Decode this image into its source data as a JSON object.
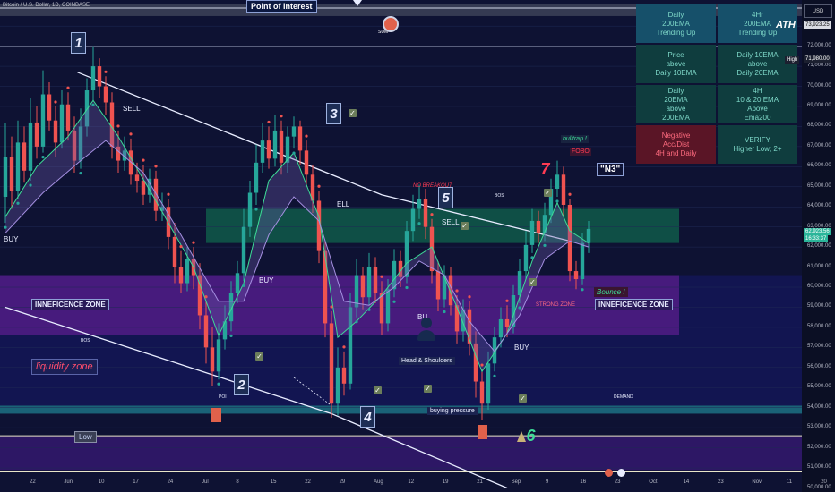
{
  "header": {
    "title": "Bitcoin / U.S. Dollar, 1D, COINBASE",
    "point_of_interest": "Point of Interest",
    "ath": "ATH",
    "currency": "USD"
  },
  "status_table": [
    {
      "text": "Daily\n200EMA\nTrending Up",
      "negative": false,
      "top": true
    },
    {
      "text": "4Hr\n200EMA\nTrending Up",
      "negative": false,
      "top": true
    },
    {
      "text": "Price\nabove\nDaily 10EMA",
      "negative": false,
      "top": false
    },
    {
      "text": "Daily 10EMA\nabove\nDaily 20EMA",
      "negative": false,
      "top": false
    },
    {
      "text": "Daily\n20EMA\nabove\n200EMA",
      "negative": false,
      "top": false
    },
    {
      "text": "4H\n10 & 20 EMA\nAbove\nEma200",
      "negative": false,
      "top": false
    },
    {
      "text": "Negative\nAcc/Dist\n4H and Daily",
      "negative": true,
      "top": false
    },
    {
      "text": "VERIFY\nHigher Low; 2+",
      "negative": false,
      "top": false
    }
  ],
  "annotations": {
    "waves": [
      "1",
      "2",
      "3",
      "4",
      "5",
      "6",
      "7"
    ],
    "labels": {
      "sell1": "SELL",
      "sell2": "SELL",
      "sell3": "ELL",
      "buy1": "BUY",
      "buy2": "BUY",
      "buy3": "BUY",
      "bu": "BU",
      "bos1": "BOS",
      "bos2": "BOS",
      "poi": "POI",
      "demand": "DEMAND",
      "head_shoulders": "Head & Shoulders",
      "buying_pressure": "buying pressure",
      "ineff_left": "INNEFICENCE ZONE",
      "ineff_right": "INNEFICENCE ZONE",
      "liquidity": "liquidity zone",
      "low": "Low",
      "bulltrap": "bulltrap !",
      "fobo": "FOBO",
      "n3": "\"N3\"",
      "bounce": "Bounce !",
      "strong_zone": "STRONG ZONE",
      "no_breakout": "NO BREAKOUT",
      "sum": "SUM"
    }
  },
  "y_axis": {
    "ticks": [
      "73,000.00",
      "72,000.00",
      "71,000.00",
      "70,000.00",
      "69,000.00",
      "68,000.00",
      "67,000.00",
      "66,000.00",
      "65,000.00",
      "64,000.00",
      "63,000.00",
      "62,000.00",
      "61,000.00",
      "60,000.00",
      "59,000.00",
      "58,000.00",
      "57,000.00",
      "56,000.00",
      "55,000.00",
      "54,000.00",
      "53,000.00",
      "52,000.00",
      "51,000.00",
      "50,000.00"
    ],
    "price_tag_top": "73,923.25",
    "high_label": "High",
    "high_value": "71,980.00",
    "last_price": "62,923.56",
    "countdown": "16:33:37"
  },
  "x_axis": {
    "ticks": [
      "22",
      "Jun",
      "10",
      "17",
      "24",
      "Jul",
      "8",
      "15",
      "22",
      "29",
      "Aug",
      "12",
      "19",
      "21",
      "Sep",
      "9",
      "16",
      "23",
      "Oct",
      "14",
      "23",
      "Nov",
      "11",
      "20"
    ]
  },
  "chart_data": {
    "type": "candlestick",
    "title": "Bitcoin / U.S. Dollar, 1D, COINBASE",
    "ylim": [
      49800,
      74300
    ],
    "x_range": [
      0,
      120
    ],
    "candles": [
      {
        "x": 0,
        "o": 64500,
        "c": 66500,
        "h": 68200,
        "l": 63200
      },
      {
        "x": 1,
        "o": 66500,
        "c": 64800,
        "h": 67500,
        "l": 63900
      },
      {
        "x": 2,
        "o": 64800,
        "c": 67200,
        "h": 68300,
        "l": 64400
      },
      {
        "x": 3,
        "o": 67200,
        "c": 65800,
        "h": 68000,
        "l": 65200
      },
      {
        "x": 4,
        "o": 65800,
        "c": 68200,
        "h": 69400,
        "l": 65300
      },
      {
        "x": 5,
        "o": 68200,
        "c": 67000,
        "h": 69000,
        "l": 66400
      },
      {
        "x": 6,
        "o": 67000,
        "c": 69600,
        "h": 70800,
        "l": 66700
      },
      {
        "x": 7,
        "o": 69600,
        "c": 68300,
        "h": 70200,
        "l": 67800
      },
      {
        "x": 8,
        "o": 68300,
        "c": 67200,
        "h": 69000,
        "l": 66500
      },
      {
        "x": 9,
        "o": 67200,
        "c": 69100,
        "h": 69800,
        "l": 66900
      },
      {
        "x": 10,
        "o": 69100,
        "c": 67800,
        "h": 69700,
        "l": 67300
      },
      {
        "x": 11,
        "o": 67800,
        "c": 66300,
        "h": 68500,
        "l": 65700
      },
      {
        "x": 12,
        "o": 66300,
        "c": 68000,
        "h": 68900,
        "l": 65900
      },
      {
        "x": 13,
        "o": 68000,
        "c": 69800,
        "h": 70400,
        "l": 67500
      },
      {
        "x": 14,
        "o": 69800,
        "c": 71000,
        "h": 72000,
        "l": 69300
      },
      {
        "x": 15,
        "o": 71000,
        "c": 70000,
        "h": 71400,
        "l": 69400
      },
      {
        "x": 16,
        "o": 70000,
        "c": 69200,
        "h": 70500,
        "l": 68600
      },
      {
        "x": 17,
        "o": 69200,
        "c": 67000,
        "h": 69700,
        "l": 66400
      },
      {
        "x": 18,
        "o": 67000,
        "c": 66300,
        "h": 67800,
        "l": 65700
      },
      {
        "x": 19,
        "o": 66300,
        "c": 66800,
        "h": 67500,
        "l": 65800
      },
      {
        "x": 20,
        "o": 66800,
        "c": 65600,
        "h": 67400,
        "l": 65100
      },
      {
        "x": 21,
        "o": 65600,
        "c": 65300,
        "h": 66200,
        "l": 64700
      },
      {
        "x": 22,
        "o": 65300,
        "c": 64600,
        "h": 66100,
        "l": 64100
      },
      {
        "x": 23,
        "o": 64600,
        "c": 65400,
        "h": 65900,
        "l": 64200
      },
      {
        "x": 24,
        "o": 65400,
        "c": 63800,
        "h": 65800,
        "l": 63300
      },
      {
        "x": 25,
        "o": 63800,
        "c": 64000,
        "h": 64700,
        "l": 63300
      },
      {
        "x": 26,
        "o": 64000,
        "c": 62500,
        "h": 64400,
        "l": 61900
      },
      {
        "x": 27,
        "o": 62500,
        "c": 61000,
        "h": 63200,
        "l": 60200
      },
      {
        "x": 28,
        "o": 61000,
        "c": 60200,
        "h": 61800,
        "l": 59700
      },
      {
        "x": 29,
        "o": 60200,
        "c": 61400,
        "h": 62000,
        "l": 59800
      },
      {
        "x": 30,
        "o": 61400,
        "c": 60600,
        "h": 62000,
        "l": 59900
      },
      {
        "x": 31,
        "o": 60600,
        "c": 58600,
        "h": 61200,
        "l": 57900
      },
      {
        "x": 32,
        "o": 58600,
        "c": 57000,
        "h": 59300,
        "l": 56200
      },
      {
        "x": 33,
        "o": 57000,
        "c": 55800,
        "h": 58000,
        "l": 55100
      },
      {
        "x": 34,
        "o": 55800,
        "c": 57400,
        "h": 58200,
        "l": 55400
      },
      {
        "x": 35,
        "o": 57400,
        "c": 58300,
        "h": 59100,
        "l": 56900
      },
      {
        "x": 36,
        "o": 58300,
        "c": 59700,
        "h": 60300,
        "l": 57800
      },
      {
        "x": 37,
        "o": 59700,
        "c": 60700,
        "h": 61300,
        "l": 59200
      },
      {
        "x": 38,
        "o": 60700,
        "c": 63000,
        "h": 63900,
        "l": 60300
      },
      {
        "x": 39,
        "o": 63000,
        "c": 64700,
        "h": 65300,
        "l": 62500
      },
      {
        "x": 40,
        "o": 64700,
        "c": 66200,
        "h": 67100,
        "l": 64100
      },
      {
        "x": 41,
        "o": 66200,
        "c": 67300,
        "h": 68200,
        "l": 65700
      },
      {
        "x": 42,
        "o": 67300,
        "c": 66400,
        "h": 68000,
        "l": 65900
      },
      {
        "x": 43,
        "o": 66400,
        "c": 67800,
        "h": 68600,
        "l": 66000
      },
      {
        "x": 44,
        "o": 67800,
        "c": 66200,
        "h": 68300,
        "l": 65600
      },
      {
        "x": 45,
        "o": 66200,
        "c": 67500,
        "h": 68000,
        "l": 65700
      },
      {
        "x": 46,
        "o": 67500,
        "c": 68000,
        "h": 68500,
        "l": 66900
      },
      {
        "x": 47,
        "o": 68000,
        "c": 66800,
        "h": 68300,
        "l": 66100
      },
      {
        "x": 48,
        "o": 66800,
        "c": 65600,
        "h": 67300,
        "l": 65000
      },
      {
        "x": 49,
        "o": 65600,
        "c": 64300,
        "h": 66100,
        "l": 63700
      },
      {
        "x": 50,
        "o": 64300,
        "c": 61800,
        "h": 64800,
        "l": 61200
      },
      {
        "x": 51,
        "o": 61800,
        "c": 58200,
        "h": 62300,
        "l": 57500
      },
      {
        "x": 52,
        "o": 58200,
        "c": 54200,
        "h": 58800,
        "l": 53500
      },
      {
        "x": 53,
        "o": 54200,
        "c": 56000,
        "h": 57000,
        "l": 53600
      },
      {
        "x": 54,
        "o": 56000,
        "c": 55200,
        "h": 56800,
        "l": 54600
      },
      {
        "x": 55,
        "o": 55200,
        "c": 59000,
        "h": 59700,
        "l": 54900
      },
      {
        "x": 56,
        "o": 59000,
        "c": 60600,
        "h": 61400,
        "l": 58500
      },
      {
        "x": 57,
        "o": 60600,
        "c": 59500,
        "h": 61000,
        "l": 58900
      },
      {
        "x": 58,
        "o": 59500,
        "c": 61000,
        "h": 61700,
        "l": 59100
      },
      {
        "x": 59,
        "o": 61000,
        "c": 59700,
        "h": 61500,
        "l": 59200
      },
      {
        "x": 60,
        "o": 59700,
        "c": 58200,
        "h": 60300,
        "l": 57600
      },
      {
        "x": 61,
        "o": 58200,
        "c": 59900,
        "h": 60400,
        "l": 57800
      },
      {
        "x": 62,
        "o": 59900,
        "c": 61300,
        "h": 61900,
        "l": 59500
      },
      {
        "x": 63,
        "o": 61300,
        "c": 60500,
        "h": 61800,
        "l": 60000
      },
      {
        "x": 64,
        "o": 60500,
        "c": 62800,
        "h": 63300,
        "l": 60200
      },
      {
        "x": 65,
        "o": 62800,
        "c": 63900,
        "h": 64600,
        "l": 62300
      },
      {
        "x": 66,
        "o": 63900,
        "c": 64400,
        "h": 65100,
        "l": 63400
      },
      {
        "x": 67,
        "o": 64400,
        "c": 63000,
        "h": 64900,
        "l": 62400
      },
      {
        "x": 68,
        "o": 63000,
        "c": 60800,
        "h": 63400,
        "l": 60200
      },
      {
        "x": 69,
        "o": 60800,
        "c": 59400,
        "h": 61300,
        "l": 58800
      },
      {
        "x": 70,
        "o": 59400,
        "c": 60600,
        "h": 61100,
        "l": 59000
      },
      {
        "x": 71,
        "o": 60600,
        "c": 59100,
        "h": 61000,
        "l": 58600
      },
      {
        "x": 72,
        "o": 59100,
        "c": 57800,
        "h": 59600,
        "l": 57200
      },
      {
        "x": 73,
        "o": 57800,
        "c": 58900,
        "h": 59400,
        "l": 57300
      },
      {
        "x": 74,
        "o": 58900,
        "c": 57200,
        "h": 59300,
        "l": 56600
      },
      {
        "x": 75,
        "o": 57200,
        "c": 55300,
        "h": 57800,
        "l": 54500
      },
      {
        "x": 76,
        "o": 55300,
        "c": 54200,
        "h": 55900,
        "l": 53400
      },
      {
        "x": 77,
        "o": 54200,
        "c": 56200,
        "h": 56800,
        "l": 53900
      },
      {
        "x": 78,
        "o": 56200,
        "c": 57500,
        "h": 58000,
        "l": 55800
      },
      {
        "x": 79,
        "o": 57500,
        "c": 58400,
        "h": 59000,
        "l": 57000
      },
      {
        "x": 80,
        "o": 58400,
        "c": 58000,
        "h": 59100,
        "l": 57500
      },
      {
        "x": 81,
        "o": 58000,
        "c": 59600,
        "h": 60100,
        "l": 57700
      },
      {
        "x": 82,
        "o": 59600,
        "c": 60800,
        "h": 61400,
        "l": 59200
      },
      {
        "x": 83,
        "o": 60800,
        "c": 62100,
        "h": 62800,
        "l": 60400
      },
      {
        "x": 84,
        "o": 62100,
        "c": 63300,
        "h": 63900,
        "l": 61700
      },
      {
        "x": 85,
        "o": 63300,
        "c": 62700,
        "h": 63800,
        "l": 62200
      },
      {
        "x": 86,
        "o": 62700,
        "c": 63600,
        "h": 64200,
        "l": 62300
      },
      {
        "x": 87,
        "o": 63600,
        "c": 64900,
        "h": 65400,
        "l": 63200
      },
      {
        "x": 88,
        "o": 64900,
        "c": 65600,
        "h": 66300,
        "l": 64500
      },
      {
        "x": 89,
        "o": 65600,
        "c": 64100,
        "h": 66000,
        "l": 63500
      },
      {
        "x": 90,
        "o": 64100,
        "c": 60800,
        "h": 64400,
        "l": 60300
      },
      {
        "x": 91,
        "o": 60800,
        "c": 60400,
        "h": 61300,
        "l": 59900
      },
      {
        "x": 92,
        "o": 60400,
        "c": 62200,
        "h": 62700,
        "l": 60100
      },
      {
        "x": 93,
        "o": 62200,
        "c": 62900,
        "h": 63300,
        "l": 61700
      }
    ],
    "ema_fast": [
      [
        0,
        63500
      ],
      [
        5,
        66000
      ],
      [
        10,
        67500
      ],
      [
        14,
        69300
      ],
      [
        18,
        67500
      ],
      [
        24,
        64300
      ],
      [
        30,
        61000
      ],
      [
        34,
        57600
      ],
      [
        38,
        60200
      ],
      [
        42,
        65300
      ],
      [
        46,
        66700
      ],
      [
        50,
        63500
      ],
      [
        53,
        57500
      ],
      [
        56,
        58300
      ],
      [
        60,
        59600
      ],
      [
        64,
        61200
      ],
      [
        68,
        62000
      ],
      [
        72,
        59000
      ],
      [
        76,
        55800
      ],
      [
        80,
        57700
      ],
      [
        84,
        61300
      ],
      [
        88,
        64200
      ],
      [
        90,
        62800
      ],
      [
        93,
        62200
      ]
    ],
    "ema_slow": [
      [
        0,
        62700
      ],
      [
        6,
        64700
      ],
      [
        12,
        66300
      ],
      [
        16,
        67300
      ],
      [
        22,
        65700
      ],
      [
        28,
        62600
      ],
      [
        34,
        59300
      ],
      [
        38,
        59300
      ],
      [
        42,
        62600
      ],
      [
        46,
        64500
      ],
      [
        50,
        63300
      ],
      [
        54,
        59300
      ],
      [
        58,
        59100
      ],
      [
        62,
        60000
      ],
      [
        66,
        61300
      ],
      [
        70,
        60600
      ],
      [
        74,
        58300
      ],
      [
        78,
        56800
      ],
      [
        82,
        58600
      ],
      [
        86,
        61400
      ],
      [
        90,
        62300
      ],
      [
        93,
        62000
      ]
    ],
    "channel_upper": [
      [
        11.5,
        70700
      ],
      [
        60.0,
        64600
      ],
      [
        90.0,
        62300
      ]
    ],
    "channel_lower": [
      [
        0,
        59000
      ],
      [
        52,
        53700
      ],
      [
        80.0,
        50000
      ]
    ],
    "zones": [
      {
        "name": "supply-green",
        "y1": 62200,
        "y2": 63900
      },
      {
        "name": "inefficiency",
        "y1": 57600,
        "y2": 60600
      },
      {
        "name": "demand",
        "y1": 53700,
        "y2": 54100
      },
      {
        "name": "low-band",
        "y1": 50900,
        "y2": 52600
      },
      {
        "name": "ath-band",
        "y1": 73500,
        "y2": 74100
      }
    ],
    "levels": [
      73900,
      71980,
      52600,
      50800
    ],
    "last_price": 62923.56,
    "high": 71980
  }
}
